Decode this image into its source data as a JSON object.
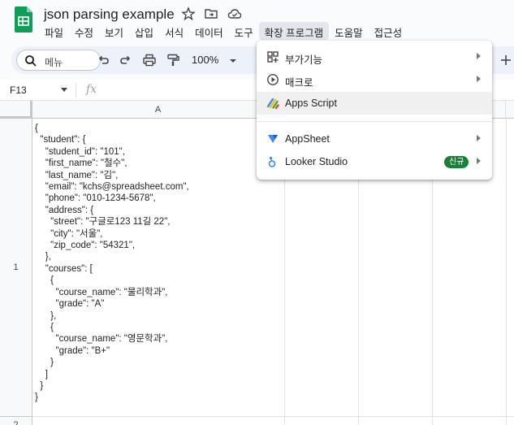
{
  "app": {
    "title": "json parsing example",
    "title_icons": [
      "star-icon",
      "move-to-folder-icon",
      "cloud-saved-icon"
    ]
  },
  "menubar": {
    "items": [
      {
        "label": "파일"
      },
      {
        "label": "수정"
      },
      {
        "label": "보기"
      },
      {
        "label": "삽입"
      },
      {
        "label": "서식"
      },
      {
        "label": "데이터"
      },
      {
        "label": "도구"
      },
      {
        "label": "확장 프로그램"
      },
      {
        "label": "도움말"
      },
      {
        "label": "접근성"
      }
    ],
    "active_index": 7
  },
  "toolbar": {
    "search_label": "메뉴",
    "zoom": "100%",
    "icons": [
      "search-icon",
      "undo-icon",
      "redo-icon",
      "print-icon",
      "paint-format-icon",
      "zoom-dropdown-icon",
      "add-icon"
    ]
  },
  "formula_bar": {
    "cell_ref": "F13",
    "fx": "fx"
  },
  "grid": {
    "columns": [
      "A"
    ],
    "rows": [
      "1",
      "2"
    ],
    "cell_a1": "{\n  \"student\": {\n    \"student_id\": \"101\",\n    \"first_name\": \"철수\",\n    \"last_name\": \"김\",\n    \"email\": \"kchs@spreadsheet.com\",\n    \"phone\": \"010-1234-5678\",\n    \"address\": {\n      \"street\": \"구글로123 11길 22\",\n      \"city\": \"서울\",\n      \"zip_code\": \"54321\",\n    },\n    \"courses\": [\n      {\n        \"course_name\": \"물리학과\",\n        \"grade\": \"A\"\n      },\n      {\n        \"course_name\": \"영문학과\",\n        \"grade\": \"B+\"\n      }\n    ]\n  }\n}"
  },
  "extensions_menu": {
    "items": [
      {
        "label": "부가기능",
        "icon": "add-ons-icon",
        "submenu": true
      },
      {
        "label": "매크로",
        "icon": "macro-play-icon",
        "submenu": true
      },
      {
        "label": "Apps Script",
        "icon": "apps-script-icon",
        "submenu": false
      },
      {
        "label": "AppSheet",
        "icon": "appsheet-icon",
        "submenu": true
      },
      {
        "label": "Looker Studio",
        "icon": "looker-studio-icon",
        "submenu": true,
        "badge": "신규"
      }
    ],
    "hover_index": 2
  },
  "colors": {
    "sheets_green": "#0f9d58",
    "badge_green": "#188038",
    "toolbar_bg": "#edf2fa",
    "menu_active_bg": "#e3e6ec"
  }
}
